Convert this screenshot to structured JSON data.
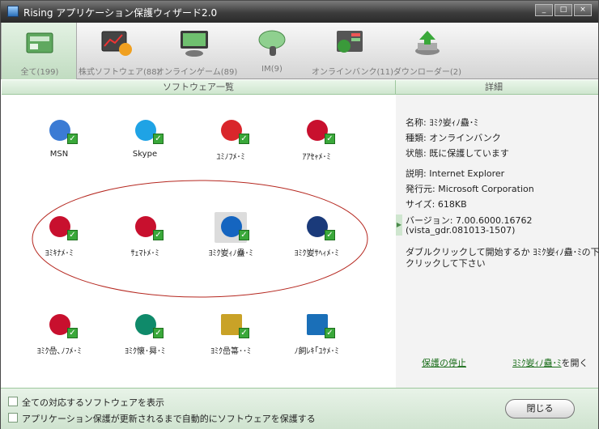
{
  "window": {
    "title": "Rising アプリケーション保護ウィザード2.0",
    "controls": [
      "_",
      "□",
      "×"
    ]
  },
  "tabs": [
    {
      "label": "全て(199)",
      "icon": "all-apps-icon",
      "active": true
    },
    {
      "label": "株式ソフトウェア(88)",
      "icon": "stock-chart-icon",
      "active": false
    },
    {
      "label": "オンラインゲーム(89)",
      "icon": "game-monitor-icon",
      "active": false
    },
    {
      "label": "IM(9)",
      "icon": "chat-bubble-icon",
      "active": false
    },
    {
      "label": "オンラインバンク(11)",
      "icon": "bank-globe-icon",
      "active": false
    },
    {
      "label": "ダウンローダー(2)",
      "icon": "download-arrow-icon",
      "active": false
    }
  ],
  "software_list": {
    "header": "ソフトウェア一覧",
    "items": [
      {
        "label": "MSN",
        "icon": "msn-icon",
        "color": "#3b7bd4"
      },
      {
        "label": "Skype",
        "icon": "skype-icon",
        "color": "#1fa3e5"
      },
      {
        "label": "ﾕﾐﾉﾌﾒ･ﾐ",
        "icon": "bank-logo-icon",
        "color": "#d9262b"
      },
      {
        "label": "ｱｱｾｬﾒ･ﾐ",
        "icon": "bank-logo-icon",
        "color": "#c8102e"
      },
      {
        "label": "ﾖﾐｷﾅﾒ･ﾐ",
        "icon": "bank-logo-icon",
        "color": "#c8102e"
      },
      {
        "label": "ｻｪﾏﾄﾒ･ﾐ",
        "icon": "bank-logo-icon",
        "color": "#c8102e"
      },
      {
        "label": "ﾖﾐｸ妛ｨﾉ蠱･ﾐ",
        "icon": "bank-logo-icon",
        "color": "#1565c0"
      },
      {
        "label": "ﾖﾐｸ妛ｻﾍｨﾒ･ﾐ",
        "icon": "bank-logo-icon",
        "color": "#1a3a7a"
      },
      {
        "label": "ﾖﾐｸ嵒､ﾉﾌﾒ･ﾐ",
        "icon": "bank-logo-icon",
        "color": "#c8102e"
      },
      {
        "label": "ﾖﾐｸ懐･曻･ﾐ",
        "icon": "bank-logo-icon",
        "color": "#0f8a6a"
      },
      {
        "label": "ﾖﾐｸ嵒箒･･ﾐ",
        "icon": "bank-logo-icon",
        "color": "#c9a227"
      },
      {
        "label": "ﾉ飼ﾚｷ｢ﾕｹﾒ･ﾐ",
        "icon": "bank-logo-icon",
        "color": "#1a6fb8"
      }
    ]
  },
  "details": {
    "header": "詳細",
    "name": "名称: ﾖﾐｸ妛ｨﾉ蠱･ﾐ",
    "type": "種類: オンラインバンク",
    "status": "状態:  既に保護しています",
    "description": "説明: Internet Explorer",
    "publisher": "発行元: Microsoft Corporation",
    "size": "サイズ: 618KB",
    "version_line1": "バージョン: 7.00.6000.16762",
    "version_line2": "(vista_gdr.081013-1507)",
    "hint_line1": "ダブルクリックして開始するか ﾖﾐｸ妛ｨﾉ蠱･ﾐの下を",
    "hint_line2": "クリックして下さい",
    "stop_link": "保護の停止",
    "open_link": "ﾖﾐｸ妛ｨﾉ蠱･ﾐ",
    "open_suffix": "を開く"
  },
  "footer": {
    "show_all_label": "全ての対応するソフトウェアを表示",
    "auto_protect_label": "アプリケーション保護が更新されるまで自動的にソフトウェアを保護する",
    "close_button": "閉じる"
  },
  "accent_color": "#3aa83a"
}
